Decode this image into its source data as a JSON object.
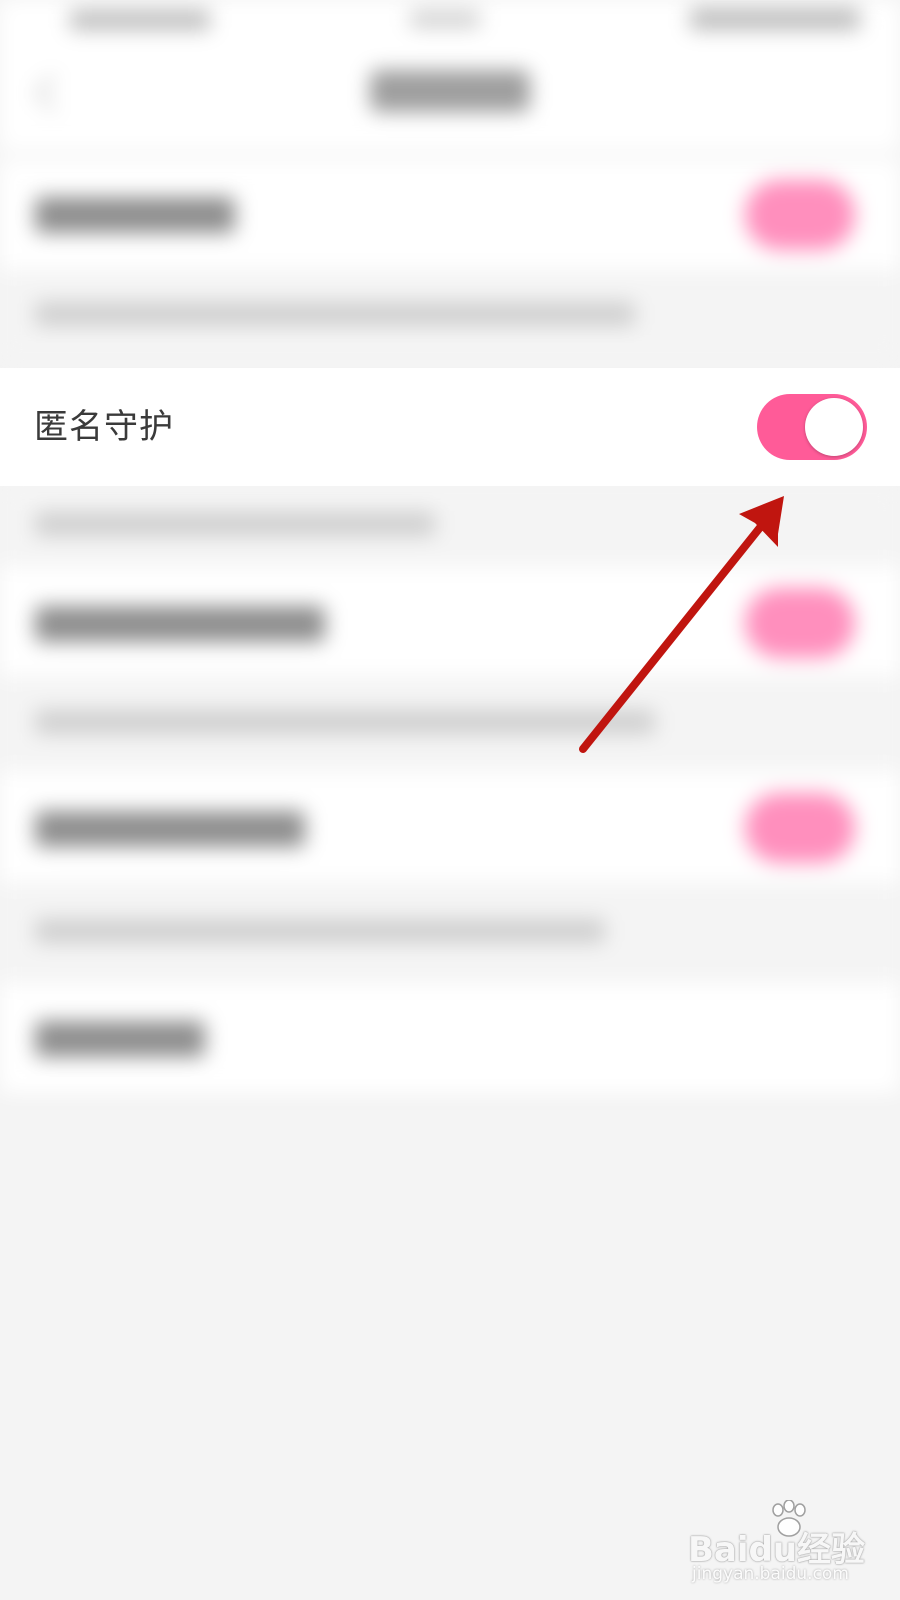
{
  "setting": {
    "label": "匿名守护",
    "toggle_on": true
  },
  "colors": {
    "toggle_active": "#ff5b98",
    "annotation_arrow": "#c0150f"
  },
  "icons": {
    "annotation": "red-arrow-icon"
  },
  "watermark": {
    "brand": "Baidu经验",
    "url": "jingyan.baidu.com"
  }
}
